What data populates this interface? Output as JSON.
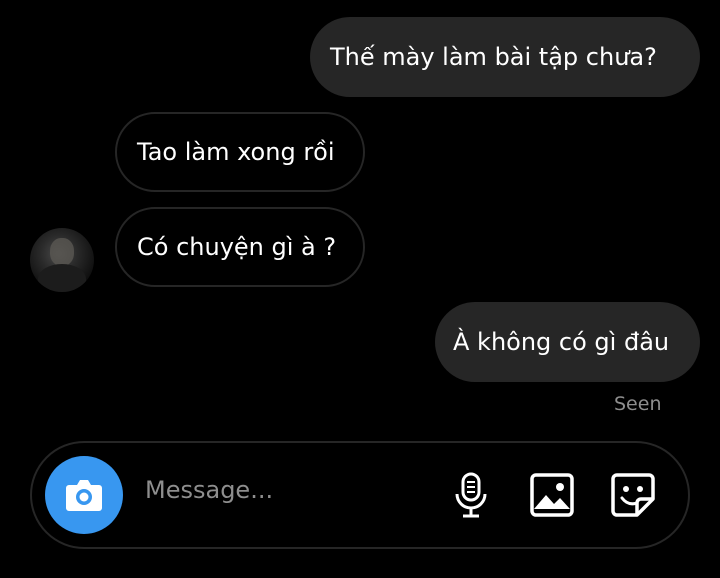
{
  "messages": [
    {
      "text": "Thế mày làm bài tập chưa?",
      "direction": "outgoing"
    },
    {
      "text": "Tao làm xong rồi",
      "direction": "incoming"
    },
    {
      "text": "Có chuyện gì à ?",
      "direction": "incoming"
    },
    {
      "text": "À không có gì đâu",
      "direction": "outgoing"
    }
  ],
  "status": {
    "seen_label": "Seen"
  },
  "composer": {
    "placeholder": "Message..."
  },
  "colors": {
    "background": "#000000",
    "bubble": "#262626",
    "accent": "#3897f0",
    "muted_text": "#8e8e8e"
  },
  "icons": [
    "camera-icon",
    "microphone-icon",
    "gallery-icon",
    "sticker-icon"
  ]
}
